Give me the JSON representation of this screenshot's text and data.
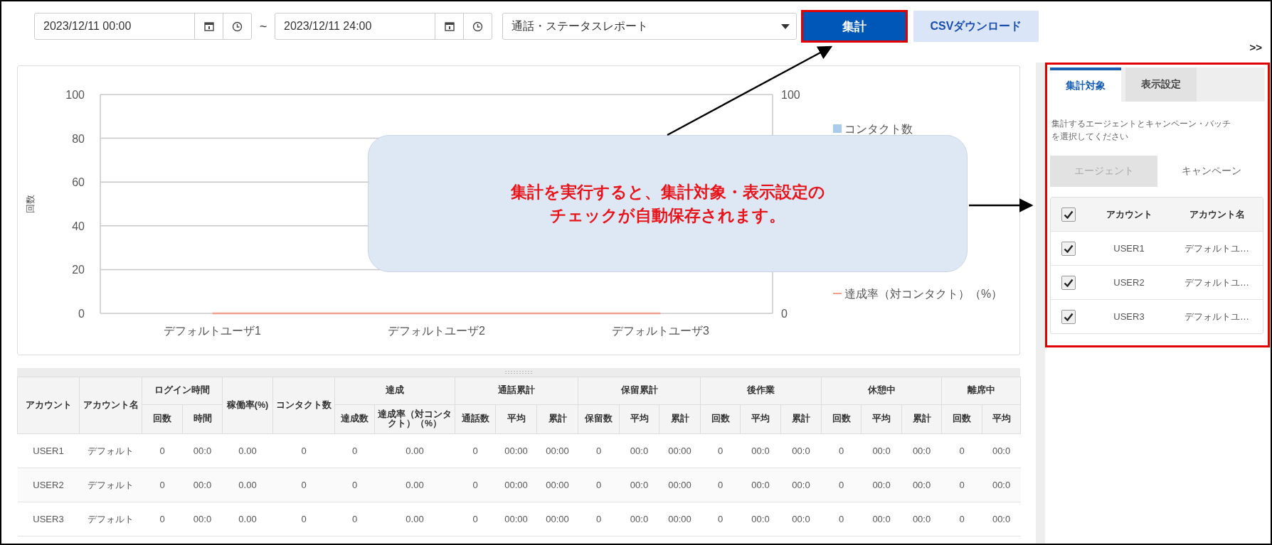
{
  "toolbar": {
    "date_from": "2023/12/11 00:00",
    "separator": "~",
    "date_to": "2023/12/11 24:00",
    "report_select": "通話・ステータスレポート",
    "aggregate_button": {
      "label": "集計",
      "highlighted": true
    },
    "csv_button": "CSVダウンロード"
  },
  "chart": {
    "chart_data": {
      "type": "bar",
      "grid": true,
      "ylabel": "回数",
      "categories": [
        "デフォルトユーザ1",
        "デフォルトユーザ2",
        "デフォルトユーザ3"
      ],
      "ylim": [
        0,
        100
      ],
      "yticks": [
        0,
        20,
        40,
        60,
        80,
        100
      ],
      "series": [
        {
          "name": "コンタクト数",
          "color": "#a9cbeb",
          "values": [
            0,
            0,
            0
          ]
        },
        {
          "name": "達成率（対コンタクト）（%）",
          "color": "#f4a08e",
          "values": [
            0,
            0,
            0
          ]
        }
      ]
    },
    "right_axis_labels": [
      "100",
      "0"
    ]
  },
  "callout": {
    "lines": [
      "集計を実行すると、集計対象・表示設定の",
      "チェックが自動保存されます。"
    ]
  },
  "table": {
    "groups": [
      {
        "label": "アカウント"
      },
      {
        "label": "アカウント名"
      },
      {
        "label": "ログイン時間",
        "children": [
          "回数",
          "時間"
        ]
      },
      {
        "label": "稼働率(%)"
      },
      {
        "label": "コンタクト数"
      },
      {
        "label": "達成",
        "children": [
          "達成数",
          "達成率（対コンタクト）（%）"
        ]
      },
      {
        "label": "通話累計",
        "children": [
          "通話数",
          "平均",
          "累計"
        ]
      },
      {
        "label": "保留累計",
        "children": [
          "保留数",
          "平均",
          "累計"
        ]
      },
      {
        "label": "後作業",
        "children": [
          "回数",
          "平均",
          "累計"
        ]
      },
      {
        "label": "休憩中",
        "children": [
          "回数",
          "平均",
          "累計"
        ]
      },
      {
        "label": "離席中",
        "children": [
          "回数",
          "平均"
        ]
      }
    ],
    "rows": [
      [
        "USER1",
        "デフォルト",
        "0",
        "00:0",
        "0.00",
        "0",
        "0",
        "0.00",
        "0",
        "00:00",
        "00:00",
        "0",
        "00:0",
        "00:00",
        "0",
        "00:0",
        "00:0",
        "0",
        "00:0",
        "00:0",
        "0",
        "00:0"
      ],
      [
        "USER2",
        "デフォルト",
        "0",
        "00:0",
        "0.00",
        "0",
        "0",
        "0.00",
        "0",
        "00:00",
        "00:00",
        "0",
        "00:0",
        "00:00",
        "0",
        "00:0",
        "00:0",
        "0",
        "00:0",
        "00:0",
        "0",
        "00:0"
      ],
      [
        "USER3",
        "デフォルト",
        "0",
        "00:0",
        "0.00",
        "0",
        "0",
        "0.00",
        "0",
        "00:00",
        "00:00",
        "0",
        "00:0",
        "00:00",
        "0",
        "00:0",
        "00:0",
        "0",
        "00:0",
        "00:0",
        "0",
        "00:0"
      ]
    ]
  },
  "side_panel": {
    "collapse_toggle": ">>",
    "highlighted": true,
    "tabs": [
      {
        "label": "集計対象",
        "selected": true
      },
      {
        "label": "表示設定",
        "selected": false
      }
    ],
    "description": "集計するエージェントとキャンペーン・バッチを選択してください",
    "segments": [
      {
        "label": "エージェント",
        "selected": true
      },
      {
        "label": "キャンペーン",
        "selected": false
      }
    ],
    "list": {
      "all_checked": true,
      "columns": [
        "アカウント",
        "アカウント名"
      ],
      "rows": [
        {
          "checked": true,
          "account": "USER1",
          "name": "デフォルトユ…"
        },
        {
          "checked": true,
          "account": "USER2",
          "name": "デフォルトユ…"
        },
        {
          "checked": true,
          "account": "USER3",
          "name": "デフォルトユ…"
        }
      ]
    }
  }
}
